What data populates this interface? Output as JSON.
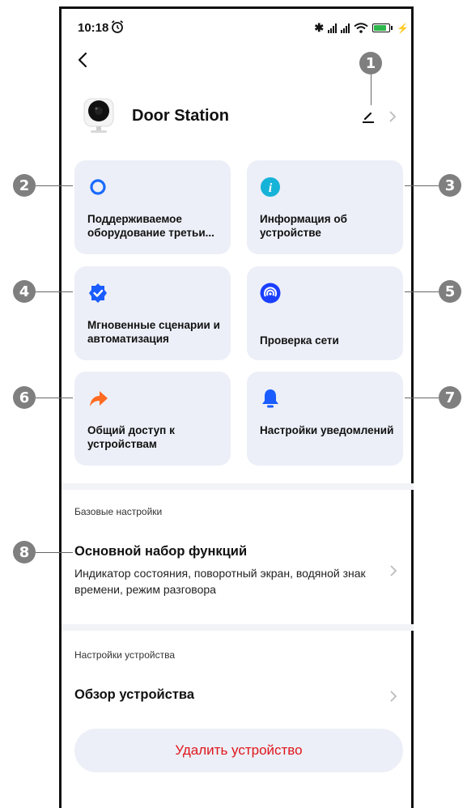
{
  "status_bar": {
    "time": "10:18"
  },
  "header": {
    "device_name": "Door Station"
  },
  "callouts": [
    "1",
    "2",
    "3",
    "4",
    "5",
    "6",
    "7",
    "8"
  ],
  "cards": [
    {
      "label": "Поддерживаемое оборудование третьи...",
      "icon": "alexa-ring-icon"
    },
    {
      "label": "Информация об устройстве",
      "icon": "info-icon"
    },
    {
      "label": "Мгновенные сценарии и автоматизация",
      "icon": "shield-check-icon"
    },
    {
      "label": "Проверка сети",
      "icon": "network-signal-icon"
    },
    {
      "label": "Общий доступ к устройствам",
      "icon": "share-arrow-icon"
    },
    {
      "label": "Настройки уведомлений",
      "icon": "bell-icon"
    }
  ],
  "basic_settings": {
    "section_title": "Базовые настройки",
    "row_title": "Основной набор функций",
    "row_subtitle": "Индикатор состояния, поворотный экран, водяной знак времени, режим разговора"
  },
  "device_settings": {
    "section_title": "Настройки устройства",
    "row_title": "Обзор устройства"
  },
  "delete_button": {
    "label": "Удалить устройство"
  },
  "colors": {
    "card_bg": "#eceff7",
    "accent_blue": "#1a5cff",
    "danger": "#e0161b",
    "share_orange": "#ff6a21",
    "info_teal": "#16b3d8"
  }
}
